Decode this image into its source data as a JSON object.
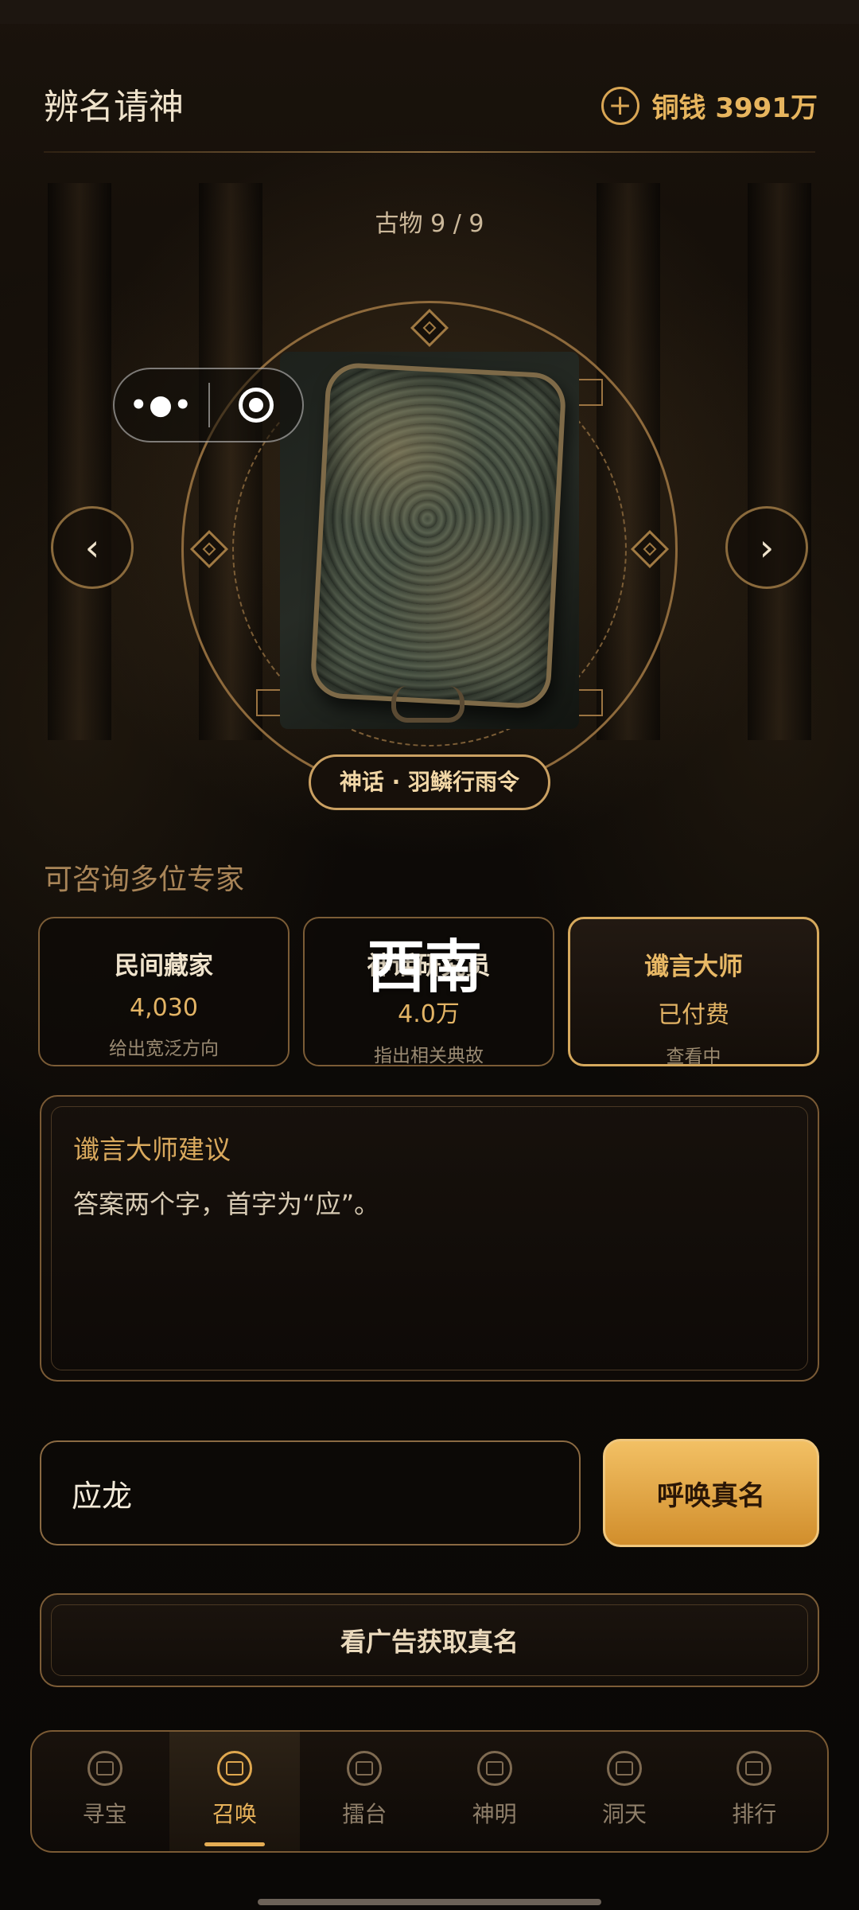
{
  "header": {
    "title": "辨名请神",
    "coins_label": "铜钱 3991万"
  },
  "artifact": {
    "counter": "古物 9 / 9",
    "name": "神话 · 羽鳞行雨令"
  },
  "experts": {
    "section_label": "可咨询多位专家",
    "cards": [
      {
        "name": "民间藏家",
        "price": "4,030",
        "desc": "给出宽泛方向"
      },
      {
        "name": "神话研究员",
        "price": "4.0万",
        "desc": "指出相关典故"
      },
      {
        "name": "谶言大师",
        "price": "已付费",
        "desc": "查看中"
      }
    ],
    "overlay_text": "西南"
  },
  "advice": {
    "title": "谶言大师建议",
    "text": "答案两个字，首字为“应”。"
  },
  "answer": {
    "value": "应龙",
    "submit_label": "呼唤真名"
  },
  "ad_button_label": "看广告获取真名",
  "tabs": [
    {
      "label": "寻宝",
      "icon": "treasure-icon"
    },
    {
      "label": "召唤",
      "icon": "summon-icon"
    },
    {
      "label": "擂台",
      "icon": "arena-icon"
    },
    {
      "label": "神明",
      "icon": "deity-icon"
    },
    {
      "label": "洞天",
      "icon": "cave-icon"
    },
    {
      "label": "排行",
      "icon": "ranking-icon"
    }
  ],
  "active_tab": "召唤",
  "colors": {
    "accent": "#e5ad54",
    "background": "#0b0806",
    "border": "#7b5c36"
  }
}
